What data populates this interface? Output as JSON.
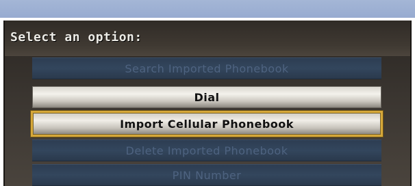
{
  "prompt": "Select an option:",
  "menu": {
    "items": [
      {
        "label": "Search Imported Phonebook",
        "state": "disabled"
      },
      {
        "label": "Dial",
        "state": "normal"
      },
      {
        "label": "Import Cellular Phonebook",
        "state": "selected"
      },
      {
        "label": "Delete Imported Phonebook",
        "state": "disabled"
      },
      {
        "label": "PIN Number",
        "state": "disabled"
      }
    ]
  },
  "colors": {
    "highlight_border": "#d6a83a",
    "disabled_background": "#33465d",
    "banner": "#a4b6d6"
  }
}
